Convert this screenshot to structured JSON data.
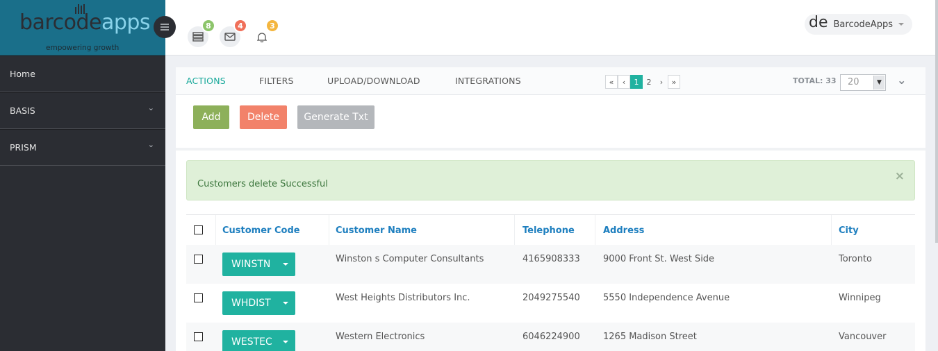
{
  "brand": {
    "logo_dark": "barcode",
    "logo_light": "apps",
    "tagline": "empowering growth"
  },
  "sidebar": {
    "items": [
      {
        "label": "Home",
        "has_children": false
      },
      {
        "label": "BASIS",
        "has_children": true
      },
      {
        "label": "PRISM",
        "has_children": true
      }
    ]
  },
  "topbar": {
    "notifications": [
      {
        "icon": "server-icon",
        "count": "8",
        "color": "#8dc56b"
      },
      {
        "icon": "envelope-icon",
        "count": "4",
        "color": "#f0705a"
      },
      {
        "icon": "bell-icon",
        "count": "3",
        "color": "#f4b63f"
      }
    ],
    "user": {
      "avatar": "de",
      "name": "BarcodeApps"
    }
  },
  "panel": {
    "tabs": [
      "ACTIONS",
      "FILTERS",
      "UPLOAD/DOWNLOAD",
      "INTEGRATIONS"
    ],
    "active_tab": "ACTIONS",
    "pagination": {
      "first": "«",
      "prev": "‹",
      "pages": [
        "1",
        "2"
      ],
      "current": "1",
      "next": "›",
      "last": "»"
    },
    "total_label": "TOTAL: 33",
    "page_size": "20",
    "buttons": {
      "add": "Add",
      "delete": "Delete",
      "generate": "Generate Txt"
    }
  },
  "alert": {
    "message": "Customers delete Successful",
    "close": "×"
  },
  "table": {
    "columns": [
      "Customer Code",
      "Customer Name",
      "Telephone",
      "Address",
      "City"
    ],
    "rows": [
      {
        "code": "WINSTN",
        "name": "Winston s Computer Consultants",
        "telephone": "4165908333",
        "address": "9000 Front St. West Side",
        "city": "Toronto"
      },
      {
        "code": "WHDIST",
        "name": "West Heights Distributors Inc.",
        "telephone": "2049275540",
        "address": "5550 Independence Avenue",
        "city": "Winnipeg"
      },
      {
        "code": "WESTEC",
        "name": "Western Electronics",
        "telephone": "6046224900",
        "address": "1265 Madison Street",
        "city": "Vancouver"
      }
    ]
  },
  "colors": {
    "accent": "#20b2a0",
    "link": "#1e7fbf",
    "sidebar": "#2b2d33",
    "logo_bg": "#1a6f8a",
    "success_bg": "#dff0d8"
  }
}
